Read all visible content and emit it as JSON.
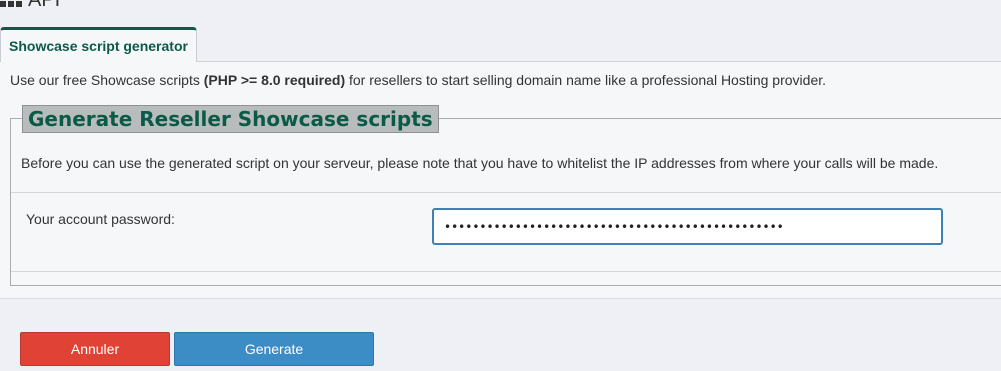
{
  "header": {
    "title": "API",
    "icon": "grid-icon"
  },
  "tabs": [
    {
      "label": "Showcase script generator",
      "active": true
    }
  ],
  "intro": {
    "before": "Use our free Showcase scripts ",
    "bold": "(PHP >= 8.0 required)",
    "after": " for resellers to start selling domain name like a professional Hosting provider."
  },
  "fieldset": {
    "legend": "Generate Reseller Showcase scripts",
    "note": "Before you can use the generated script on your serveur, please note that you have to whitelist the IP addresses from where your calls will be made.",
    "password_label": "Your account password:",
    "password_value": "••••••••••••••••••••••••••••••••••••••••••••••••"
  },
  "buttons": {
    "cancel_label": "Annuler",
    "generate_label": "Generate"
  },
  "colors": {
    "accent": "#0b5a47",
    "cancel": "#e04335",
    "primary": "#3c8dc5",
    "input_border": "#3f7fb6"
  }
}
